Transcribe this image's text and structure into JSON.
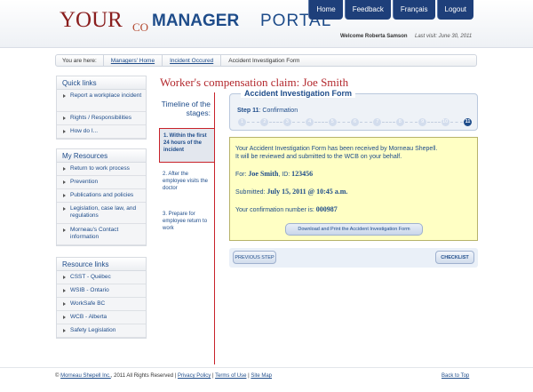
{
  "header": {
    "logo": {
      "your": "YOUR",
      "co": "CO",
      "manager": "MANAGER",
      "portal": "PORTAL"
    },
    "nav": [
      "Home",
      "Feedback",
      "Français",
      "Logout"
    ],
    "welcome": "Welcome Roberta Samson",
    "last_visit": "Last visit: June 30, 2011"
  },
  "breadcrumb": {
    "label": "You are here:",
    "links": [
      "Managers' Home",
      "Incident Occured"
    ],
    "current": "Accident Investigation Form"
  },
  "sidebar": {
    "quick_links": {
      "title": "Quick links",
      "items": [
        "Report a workplace incident",
        "Rights / Responsibilities",
        "How do I..."
      ]
    },
    "my_resources": {
      "title": "My Resources",
      "items": [
        "Return to work process",
        "Prevention",
        "Publications and policies",
        "Legislation, case law, and regulations",
        "Morneau's Contact information"
      ]
    },
    "resource_links": {
      "title": "Resource links",
      "items": [
        "CSST - Québec",
        "WSIB - Ontario",
        "WorkSafe BC",
        "WCB - Alberta",
        "Safety Legislation"
      ]
    }
  },
  "main": {
    "title": "Worker's compensation claim: Joe Smith",
    "timeline": {
      "title": "Timeline of the stages:",
      "steps": [
        "1. Within the first 24 hours of the incident",
        "2. After the employee visits the doctor",
        "3. Prepare for employee return to work"
      ]
    },
    "form": {
      "title": "Accident Investigation Form",
      "step_label": "Step 11",
      "step_name": ": Confirmation",
      "steps": [
        "1",
        "2",
        "3",
        "4",
        "5",
        "6",
        "7",
        "8",
        "9",
        "10",
        "11"
      ],
      "active_step": 11
    },
    "confirmation": {
      "line1": "Your Accident Investigation Form has been received by Morneau Shepell.",
      "line2": "It will be reviewed and submitted to the WCB on your behalf.",
      "for_label": "For: ",
      "for_name": "Joe Smith",
      "id_label": ", ID: ",
      "id_value": "123456",
      "submitted_label": "Submitted: ",
      "submitted_value": "July 15, 2011 @ 10:45 a.m.",
      "conf_label": "Your confirmation number is: ",
      "conf_value": "000987",
      "download_button": "Download and Print the Accident Investigation Form"
    },
    "buttons": {
      "previous": "PREVIOUS STEP",
      "checklist": "CHECKLIST"
    }
  },
  "footer": {
    "copyright_prefix": "© ",
    "company": "Morneau Shepell Inc.",
    "copyright_suffix": ", 2011  All Rights Reserved | ",
    "privacy": "Privacy Policy",
    "sep1": " | ",
    "terms": "Terms of Use",
    "sep2": " | ",
    "sitemap": "Site Map",
    "back_to_top": "Back to Top"
  },
  "colors": {
    "brand_blue": "#1e4c8a",
    "brand_red": "#b3282d",
    "nav_bg": "#1e3f7a",
    "confirm_bg": "#ffffc4"
  }
}
